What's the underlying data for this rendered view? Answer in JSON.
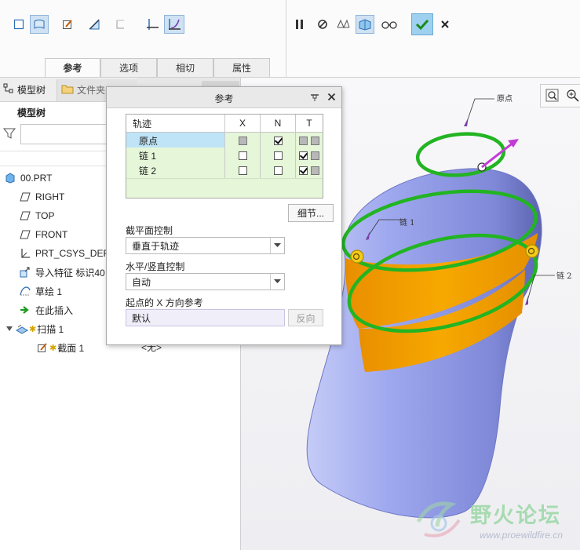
{
  "ribbon": {
    "tabs": [
      {
        "label": "参考",
        "active": true
      },
      {
        "label": "选项",
        "active": false
      },
      {
        "label": "相切",
        "active": false
      },
      {
        "label": "属性",
        "active": false
      }
    ]
  },
  "left_panel": {
    "tab_model_tree": "模型树",
    "tab_file_browser": "文件夹",
    "heading": "模型树",
    "tree": [
      {
        "label": "00.PRT",
        "icon": "part-icon"
      },
      {
        "label": "RIGHT",
        "icon": "datum-plane-icon"
      },
      {
        "label": "TOP",
        "icon": "datum-plane-icon"
      },
      {
        "label": "FRONT",
        "icon": "datum-plane-icon"
      },
      {
        "label": "PRT_CSYS_DEF",
        "icon": "csys-icon"
      },
      {
        "label": "导入特征 标识40",
        "icon": "import-feature-icon"
      },
      {
        "label": "草绘 1",
        "icon": "sketch-icon"
      },
      {
        "label": "在此插入",
        "icon": "insert-here-arrow-icon"
      },
      {
        "label": "扫描 1",
        "icon": "sweep-icon"
      },
      {
        "label": "截面 1",
        "icon": "section-icon"
      }
    ],
    "mid_strip_text": "<无>"
  },
  "dialog": {
    "title": "参考",
    "table": {
      "headers": [
        "轨迹",
        "X",
        "N",
        "T"
      ],
      "rows": [
        {
          "name": "原点",
          "x": "gray",
          "n": "checked",
          "t": [
            "gray",
            "gray"
          ],
          "selected": true
        },
        {
          "name": "链 1",
          "x": "empty",
          "n": "empty",
          "t": [
            "checked",
            "gray"
          ],
          "selected": false
        },
        {
          "name": "链 2",
          "x": "empty",
          "n": "empty",
          "t": [
            "checked",
            "gray"
          ],
          "selected": false
        }
      ]
    },
    "details_button": "细节...",
    "section_plane_label": "截平面控制",
    "section_plane_value": "垂直于轨迹",
    "hv_control_label": "水平/竖直控制",
    "hv_control_value": "自动",
    "x_ref_label": "起点的 X 方向参考",
    "x_ref_value": "默认",
    "reverse_button": "反向"
  },
  "viewport": {
    "labels": {
      "origin": "原点",
      "chain1": "链 1",
      "chain2": "链 2"
    }
  },
  "watermark": {
    "title": "野火论坛",
    "url": "www.proewildfire.cn"
  },
  "colors": {
    "selection": "#bfe4f7",
    "row_bg": "#e6f6d9",
    "accent_green": "#22b422",
    "body_blue": "#9ba6ee",
    "orange": "#f5a200",
    "vector_magenta": "#c23bd6"
  }
}
